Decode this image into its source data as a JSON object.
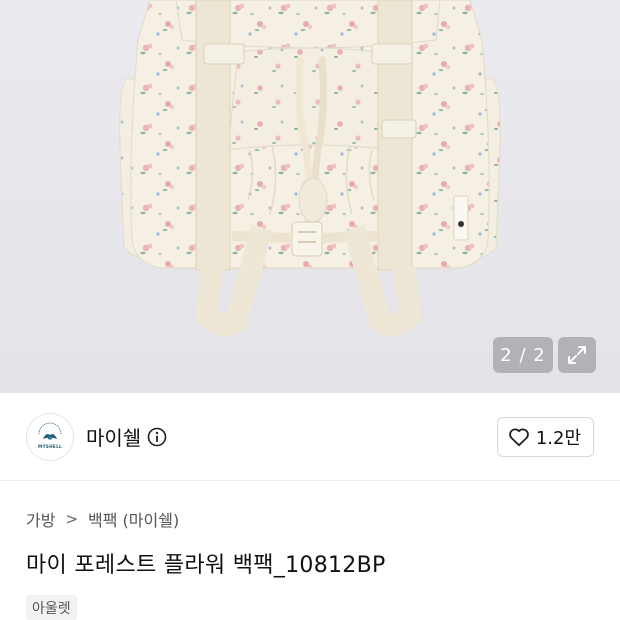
{
  "gallery": {
    "counter": "2 / 2",
    "expand_icon": "expand-arrows-icon",
    "image_subject": "floral-backpack"
  },
  "brand": {
    "name": "마이쉘",
    "logo_text": "MYSHELL",
    "info_icon": "info-circle-icon"
  },
  "like": {
    "icon": "heart-outline-icon",
    "count": "1.2만"
  },
  "breadcrumb": {
    "items": [
      "가방",
      "백팩 (마이쉘)"
    ],
    "separator": ">"
  },
  "product": {
    "title": "마이 포레스트 플라워 백팩_10812BP",
    "tag": "아울렛"
  },
  "colors": {
    "hero_bg": "#e8e7ec",
    "bag_fabric": "#f5f0e3",
    "strap": "#ece4d2",
    "flower_pink": "#e8a9ad",
    "leaf_green": "#8fb3a2"
  }
}
